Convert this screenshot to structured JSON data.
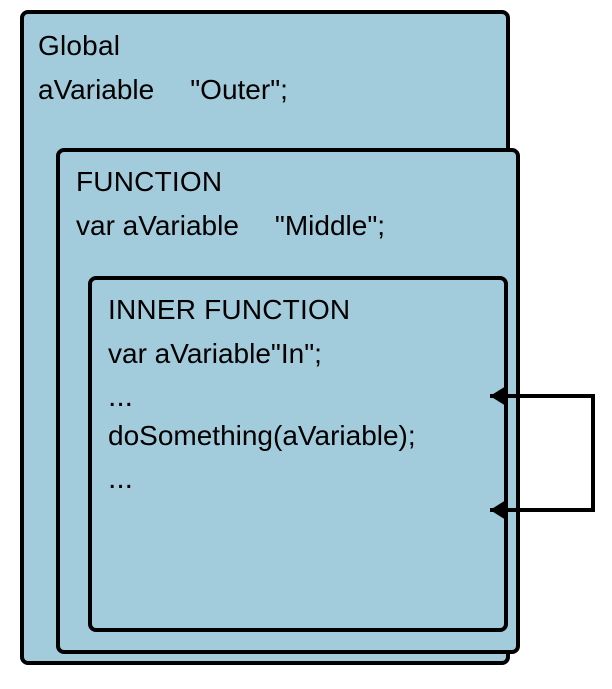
{
  "global": {
    "title": "Global",
    "var_name": "aVariable",
    "var_value": "\"Outer\";"
  },
  "function": {
    "title": "FUNCTION",
    "decl_prefix": "var aVariable",
    "decl_value": "\"Middle\";"
  },
  "inner": {
    "title": "INNER FUNCTION",
    "decl_prefix": "var aVariable",
    "decl_value": "\"In\";",
    "ellipsis1": "...",
    "call_line": "doSomething(aVariable);",
    "ellipsis2": "..."
  }
}
